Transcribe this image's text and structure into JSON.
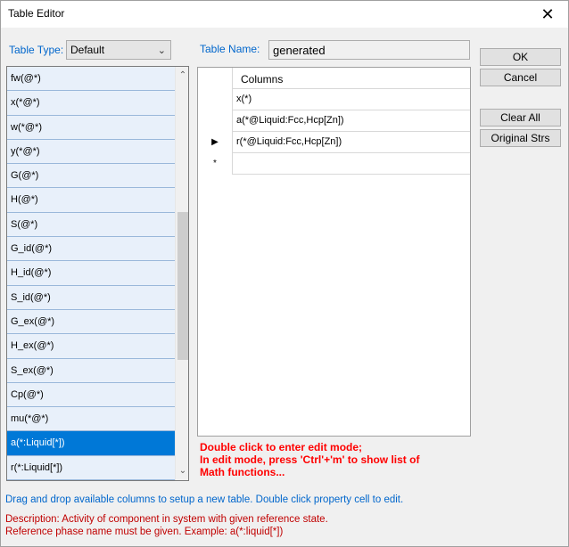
{
  "window": {
    "title": "Table Editor",
    "close_glyph": "✕"
  },
  "table_type": {
    "label": "Table Type:",
    "value": "Default"
  },
  "table_name": {
    "label": "Table Name:",
    "value": "generated"
  },
  "buttons": {
    "ok": "OK",
    "cancel": "Cancel",
    "clear_all": "Clear All",
    "original_strs": "Original Strs"
  },
  "available_columns": [
    "fw(@*)",
    "x(*@*)",
    "w(*@*)",
    "y(*@*)",
    "G(@*)",
    "H(@*)",
    "S(@*)",
    "G_id(@*)",
    "H_id(@*)",
    "S_id(@*)",
    "G_ex(@*)",
    "H_ex(@*)",
    "S_ex(@*)",
    "Cp(@*)",
    "mu(*@*)",
    "a(*:Liquid[*])",
    "r(*:Liquid[*])"
  ],
  "selected_index": 15,
  "grid": {
    "header": "Columns",
    "rows": [
      {
        "marker": "",
        "value": "x(*)"
      },
      {
        "marker": "",
        "value": "a(*@Liquid:Fcc,Hcp[Zn])"
      },
      {
        "marker": "▶",
        "value": "r(*@Liquid:Fcc,Hcp[Zn])"
      },
      {
        "marker": "*",
        "value": ""
      }
    ]
  },
  "edit_hint": {
    "line1": "Double click to enter edit mode;",
    "line2": "In edit mode, press 'Ctrl'+'m' to show list of",
    "line3": "Math functions..."
  },
  "footer": {
    "hint": "Drag and drop available columns to setup a new table. Double click property cell to edit.",
    "description_line1": "Description: Activity of component in system with given reference state.",
    "description_line2": "Reference phase name must be given. Example: a(*:liquid[*])"
  },
  "icons": {
    "close": "close-icon",
    "dropdown": "chevron-down-icon",
    "scroll_up": "scroll-up-arrow-icon",
    "scroll_down": "scroll-down-arrow-icon",
    "row_pointer": "row-pointer-icon",
    "new_row": "new-row-asterisk-icon"
  },
  "colors": {
    "selection": "#0078d7",
    "label_blue": "#0066cc",
    "hint_red": "#ff0000",
    "description_red": "#c00000"
  }
}
